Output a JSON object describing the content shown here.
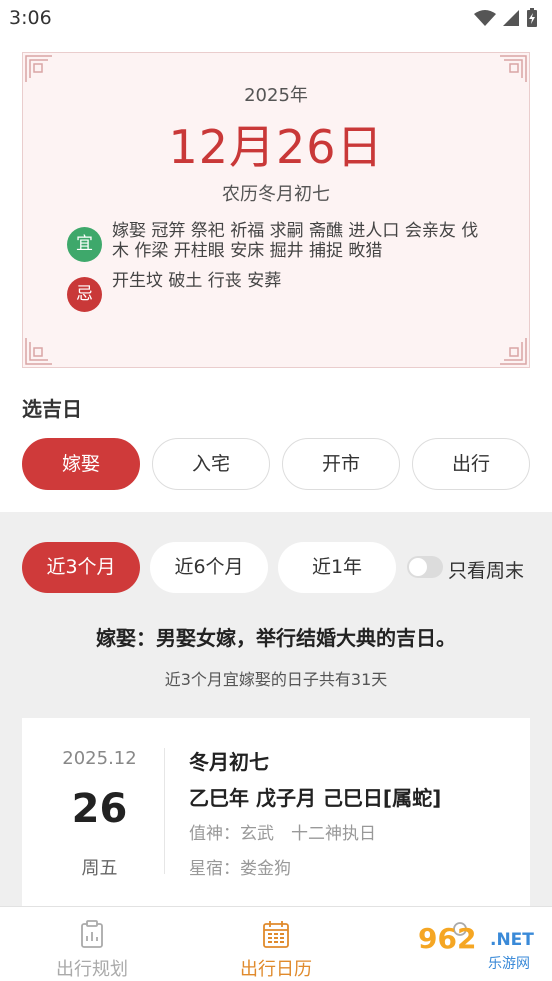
{
  "status_bar": {
    "time": "3:06"
  },
  "calendar": {
    "year": "2025年",
    "date": "12月26日",
    "lunar": "农历冬月初七",
    "yi_label": "宜",
    "yi_text": "嫁娶 冠笄 祭祀 祈福 求嗣 斋醮 进人口 会亲友 伐木 作梁 开柱眼 安床 掘井 捕捉 畋猎",
    "ji_label": "忌",
    "ji_text": "开生坟 破土 行丧 安葬"
  },
  "select_day": {
    "title": "选吉日",
    "categories": [
      "嫁娶",
      "入宅",
      "开市",
      "出行"
    ],
    "ranges": [
      "近3个月",
      "近6个月",
      "近1年"
    ],
    "weekend_label": "只看周末",
    "weekend_enabled": false
  },
  "description": {
    "title": "嫁娶：男娶女嫁，举行结婚大典的吉日。",
    "count": "近3个月宜嫁娶的日子共有31天"
  },
  "day_card": {
    "month": "2025.12",
    "day": "26",
    "weekday": "周五",
    "lunar": "冬月初七",
    "ganzhi": "乙巳年 戊子月 己巳日[属蛇]",
    "zhishen": "值神：玄武　十二神执日",
    "xingsu": "星宿：娄金狗"
  },
  "bottom_nav": {
    "items": [
      {
        "label": "出行规划",
        "icon": "clipboard-icon",
        "active": false
      },
      {
        "label": "出行日历",
        "icon": "calendar-icon",
        "active": true
      },
      {
        "label": "",
        "icon": "profile-icon",
        "active": false
      }
    ]
  },
  "watermark": {
    "brand": "962",
    "suffix": ".NET",
    "sub": "乐游网"
  },
  "colors": {
    "accent": "#cf3a3a",
    "yi": "#3ea86b",
    "nav_active": "#e08a2c",
    "card_bg": "#fdf3f3"
  }
}
